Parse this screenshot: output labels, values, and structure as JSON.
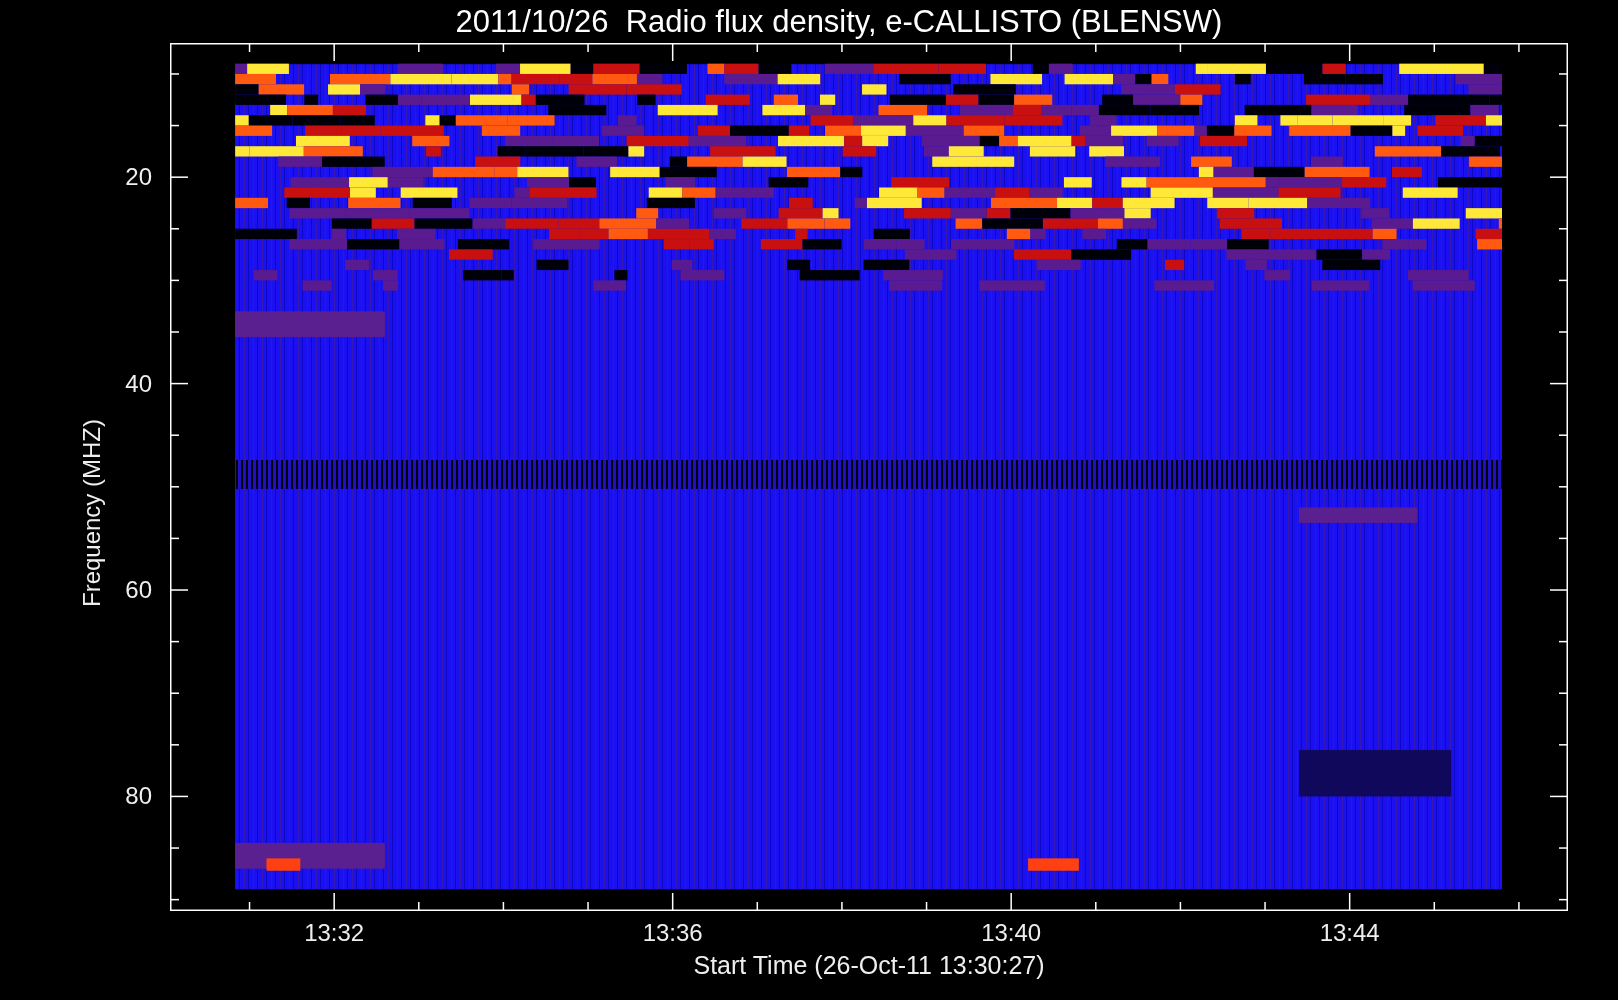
{
  "title": "2011/10/26  Radio flux density, e-CALLISTO (BLENSW)",
  "y_axis": {
    "label": "Frequency (MHZ)",
    "ticks": [
      "20",
      "40",
      "60",
      "80"
    ]
  },
  "x_axis": {
    "label": "Start Time (26-Oct-11 13:30:27)",
    "ticks": [
      "13:32",
      "13:36",
      "13:40",
      "13:44"
    ]
  }
}
